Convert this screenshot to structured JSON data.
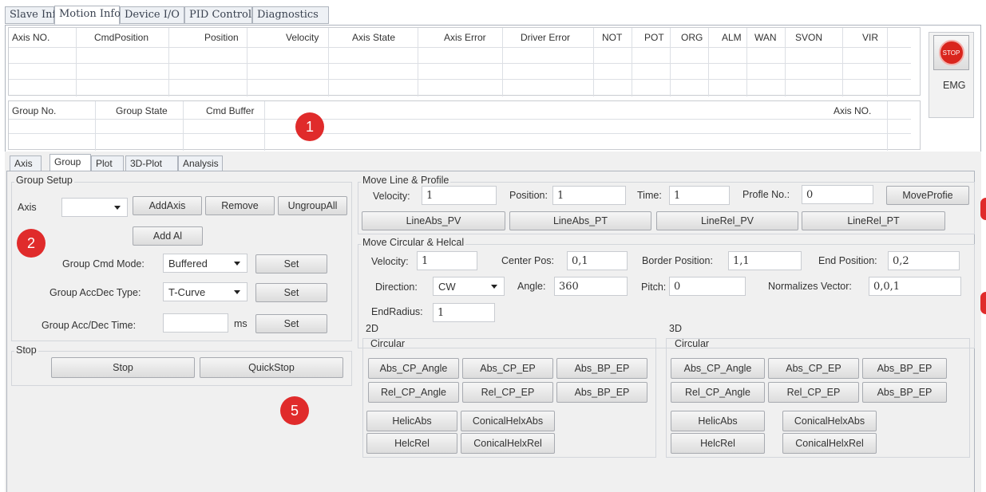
{
  "top_tabs": [
    "Slave Info",
    "Motion Info",
    "Device I/O",
    "PID Control",
    "Diagnostics"
  ],
  "axis_table": {
    "columns": [
      "Axis NO.",
      "CmdPosition",
      "Position",
      "Velocity",
      "Axis State",
      "Axis Error",
      "Driver Error",
      "NOT",
      "POT",
      "ORG",
      "ALM",
      "WAN",
      "SVON",
      "VIR"
    ]
  },
  "group_table": {
    "columns": [
      "Group No.",
      "Group State",
      "Cmd Buffer",
      "Axis NO."
    ]
  },
  "emg": {
    "icon_text": "STOP",
    "label": "EMG"
  },
  "sub_tabs": [
    "Axis",
    "Group",
    "Plot",
    "3D-Plot",
    "Analysis"
  ],
  "group_setup": {
    "title": "Group Setup",
    "axis_label": "Axis",
    "axis_value": "",
    "add_axis": "AddAxis",
    "remove": "Remove",
    "ungroup_all": "UngroupAll",
    "add_all": "Add Al",
    "cmd_mode_label": "Group Cmd Mode:",
    "cmd_mode_value": "Buffered",
    "accdec_type_label": "Group AccDec Type:",
    "accdec_type_value": "T-Curve",
    "accdec_time_label": "Group Acc/Dec Time:",
    "accdec_time_value": "",
    "ms": "ms",
    "set": "Set"
  },
  "stop_group": {
    "title": "Stop",
    "stop": "Stop",
    "quickstop": "QuickStop"
  },
  "move_line": {
    "title": "Move Line & Profile",
    "velocity_label": "Velocity:",
    "velocity_value": "1",
    "position_label": "Position:",
    "position_value": "1",
    "time_label": "Time:",
    "time_value": "1",
    "profile_label": "Profle No.:",
    "profile_value": "0",
    "move_profile": "MoveProfie",
    "line_buttons": [
      "LineAbs_PV",
      "LineAbs_PT",
      "LineRel_PV",
      "LineRel_PT"
    ]
  },
  "move_circ": {
    "title": "Move Circular & Helcal",
    "velocity_label": "Velocity:",
    "velocity_value": "1",
    "center_label": "Center Pos:",
    "center_value": "0,1",
    "border_label": "Border Position:",
    "border_value": "1,1",
    "end_label": "End Position:",
    "end_value": "0,2",
    "direction_label": "Direction:",
    "direction_value": "CW",
    "angle_label": "Angle:",
    "angle_value": "360",
    "pitch_label": "Pitch:",
    "pitch_value": "0",
    "normal_label": "Normalizes Vector:",
    "normal_value": "0,0,1",
    "endradius_label": "EndRadius:",
    "endradius_value": "1",
    "label_2d": "2D",
    "label_3d": "3D",
    "circular": "Circular",
    "circ_buttons": [
      "Abs_CP_Angle",
      "Abs_CP_EP",
      "Abs_BP_EP",
      "Rel_CP_Angle",
      "Rel_CP_EP",
      "Abs_BP_EP"
    ],
    "helix_buttons": [
      "HelicAbs",
      "ConicalHelxAbs",
      "HelcRel",
      "ConicalHelxRel"
    ]
  },
  "badges": [
    "1",
    "2",
    "5"
  ],
  "colors": {
    "badge": "#e02b2b",
    "stop_icon": "#d9251d"
  }
}
